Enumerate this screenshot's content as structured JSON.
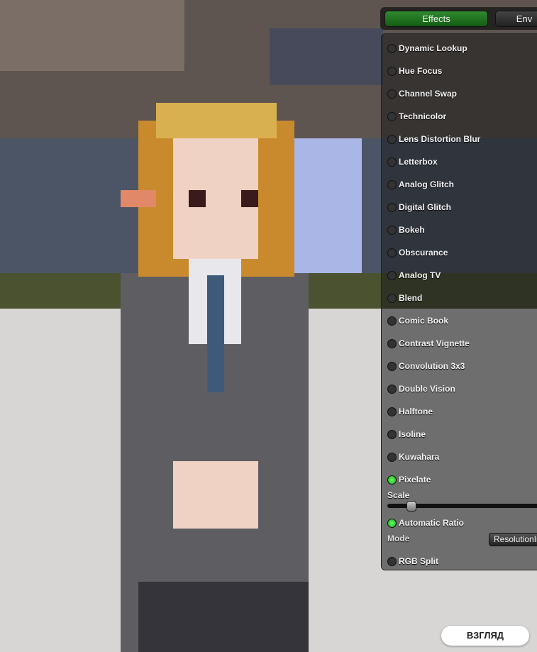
{
  "tabs": [
    {
      "label": "Effects",
      "active": true
    },
    {
      "label": "Env",
      "active": false
    }
  ],
  "effects": [
    {
      "label": "Dynamic Lookup",
      "enabled": false
    },
    {
      "label": "Hue Focus",
      "enabled": false
    },
    {
      "label": "Channel Swap",
      "enabled": false
    },
    {
      "label": "Technicolor",
      "enabled": false
    },
    {
      "label": "Lens Distortion Blur",
      "enabled": false
    },
    {
      "label": "Letterbox",
      "enabled": false
    },
    {
      "label": "Analog Glitch",
      "enabled": false
    },
    {
      "label": "Digital Glitch",
      "enabled": false
    },
    {
      "label": "Bokeh",
      "enabled": false
    },
    {
      "label": "Obscurance",
      "enabled": false
    },
    {
      "label": "Analog TV",
      "enabled": false
    },
    {
      "label": "Blend",
      "enabled": false
    },
    {
      "label": "Comic Book",
      "enabled": false
    },
    {
      "label": "Contrast Vignette",
      "enabled": false
    },
    {
      "label": "Convolution 3x3",
      "enabled": false
    },
    {
      "label": "Double Vision",
      "enabled": false
    },
    {
      "label": "Halftone",
      "enabled": false
    },
    {
      "label": "Isoline",
      "enabled": false
    },
    {
      "label": "Kuwahara",
      "enabled": false
    },
    {
      "label": "Pixelate",
      "enabled": true
    }
  ],
  "pixelate": {
    "scale_label": "Scale",
    "scale_value": 0.15,
    "auto_ratio_label": "Automatic Ratio",
    "auto_ratio": true,
    "mode_label": "Mode",
    "mode_value": "ResolutionIndependent"
  },
  "last_effect": {
    "label": "RGB Split",
    "enabled": false
  },
  "look_button": "ВЗГЛЯД"
}
